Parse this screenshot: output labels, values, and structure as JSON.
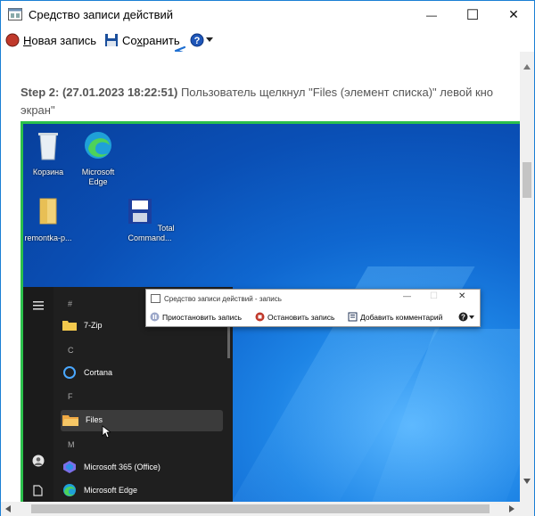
{
  "window": {
    "title": "Средство записи действий",
    "minimize_glyph": "—",
    "maximize_glyph": "☐",
    "close_glyph": "✕"
  },
  "toolbar": {
    "new_record_label": "Новая запись",
    "new_record_accel": "Н",
    "new_record_rest": "овая запись",
    "save_label": "Сохранить",
    "save_prefix": "Со",
    "save_accel": "х",
    "save_rest": "ранить",
    "help_icon": "question-circle-icon"
  },
  "step": {
    "header": "Step 2: (27.01.2023 18:22:51)",
    "text_line1": " Пользователь щелкнул \"Files (элемент списка)\" левой кно",
    "text_line2": "экран\""
  },
  "screenshot": {
    "desktop_icons": [
      {
        "label": "Корзина",
        "icon": "recycle-bin-icon"
      },
      {
        "label": "Microsoft Edge",
        "icon": "edge-icon"
      },
      {
        "label": "remontka-p...",
        "icon": "folder-icon"
      },
      {
        "label": "Total Command...",
        "icon": "total-commander-icon"
      }
    ],
    "start_menu": {
      "headers": [
        "#",
        "C",
        "F",
        "M"
      ],
      "items": [
        "7-Zip",
        "Cortana",
        "Files",
        "Microsoft 365 (Office)",
        "Microsoft Edge"
      ]
    },
    "recorder_window": {
      "title": "Средство записи действий - запись",
      "pause_label": "Приостановить запись",
      "stop_label": "Остановить запись",
      "comment_label": "Добавить комментарий"
    }
  },
  "colors": {
    "accent": "#1a7fd4",
    "highlight_border": "#2bc04c",
    "record_red": "#c0392b",
    "desktop_blue": "#0a63c9"
  }
}
